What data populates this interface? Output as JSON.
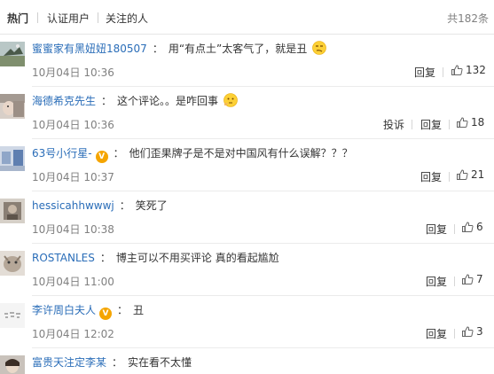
{
  "tabs": [
    "热门",
    "认证用户",
    "关注的人"
  ],
  "total": "共182条",
  "actions": {
    "reply": "回复",
    "report": "投诉"
  },
  "comments": [
    {
      "user": "蜜蜜家有黑妞妞180507",
      "text": "用“有点土”太客气了，就是丑",
      "emoji": "smirk-emoji",
      "time": "10月04日 10:36",
      "likes": "132",
      "verified": false,
      "report": false
    },
    {
      "user": "海德希克先生",
      "text": "这个评论。。是咋回事",
      "emoji": "thinking-emoji",
      "time": "10月04日 10:36",
      "likes": "18",
      "verified": false,
      "report": true
    },
    {
      "user": "63号小行星-",
      "text": "他们歪果牌子是不是对中国风有什么误解？？？",
      "emoji": "",
      "time": "10月04日 10:37",
      "likes": "21",
      "verified": true,
      "report": false
    },
    {
      "user": "hessicahhwwwj",
      "text": "笑死了",
      "emoji": "",
      "time": "10月04日 10:38",
      "likes": "6",
      "verified": false,
      "report": false
    },
    {
      "user": "ROSTANLES",
      "text": "博主可以不用买评论 真的看起尴尬",
      "emoji": "",
      "time": "10月04日 11:00",
      "likes": "7",
      "verified": false,
      "report": false
    },
    {
      "user": "李许周白夫人",
      "text": "丑",
      "emoji": "",
      "time": "10月04日 12:02",
      "likes": "3",
      "verified": true,
      "report": false
    },
    {
      "user": "富贵天注定李某",
      "text": "实在看不太懂",
      "emoji": "",
      "time": "",
      "likes": "",
      "verified": false,
      "report": false
    }
  ],
  "colors": {
    "username": "#2a6db8",
    "time": "#808080",
    "badge": "#f5a500"
  }
}
